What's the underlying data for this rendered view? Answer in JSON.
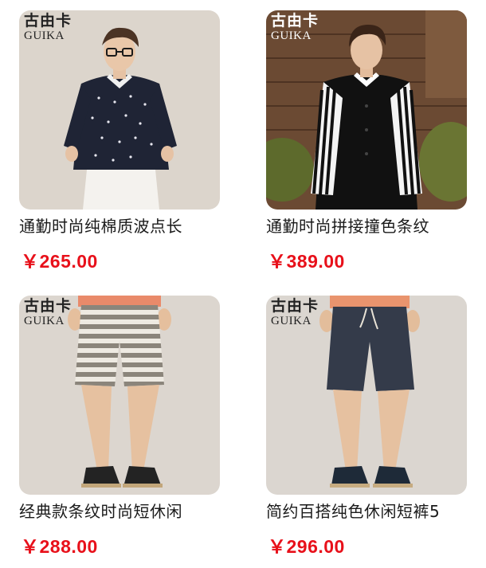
{
  "products": [
    {
      "brand_cn": "古由卡",
      "brand_en": "GUIKA",
      "title": "通勤时尚纯棉质波点长",
      "price": "￥265.00",
      "photo_icon": "man-polka-dot-shirt"
    },
    {
      "brand_cn": "古由卡",
      "brand_en": "GUIKA",
      "title": "通勤时尚拼接撞色条纹",
      "price": "￥389.00",
      "photo_icon": "man-striped-sleeve-shirt"
    },
    {
      "brand_cn": "古由卡",
      "brand_en": "GUIKA",
      "title": "经典款条纹时尚短休闲",
      "price": "￥288.00",
      "photo_icon": "striped-shorts"
    },
    {
      "brand_cn": "古由卡",
      "brand_en": "GUIKA",
      "title": "简约百搭纯色休闲短裤5",
      "price": "￥296.00",
      "photo_icon": "navy-shorts"
    }
  ],
  "colors": {
    "price": "#e8101a",
    "title": "#1a1a1a",
    "background": "#ffffff"
  }
}
